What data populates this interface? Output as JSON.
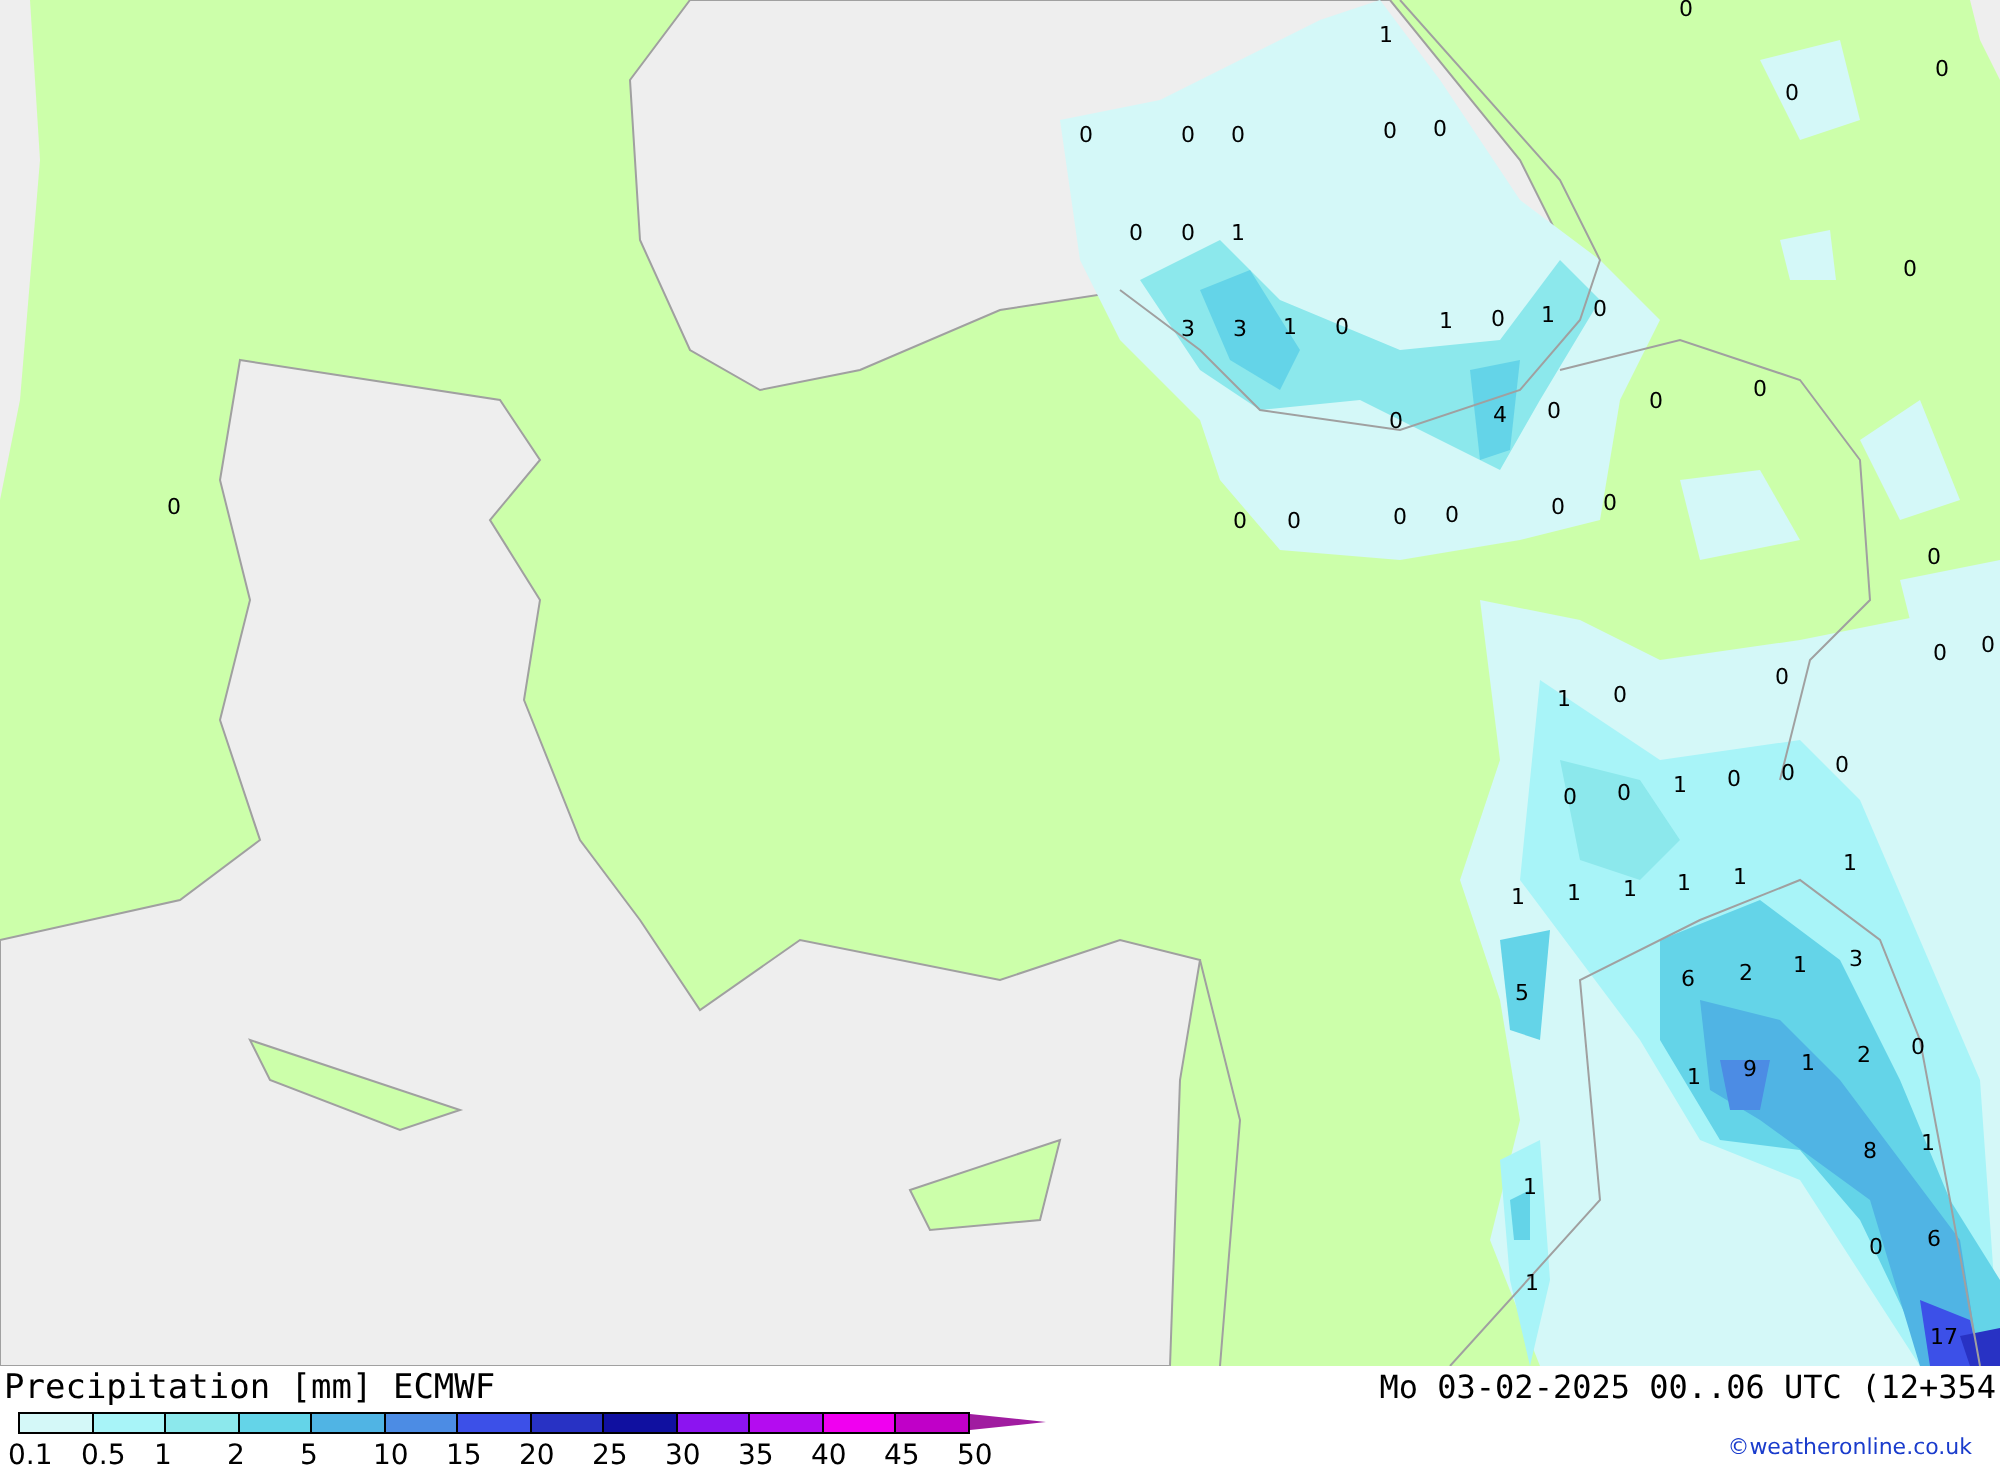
{
  "map": {
    "values": [
      "1",
      "0",
      "0",
      "0",
      "0",
      "0",
      "0",
      "0",
      "0",
      "0",
      "0",
      "1",
      "3",
      "3",
      "1",
      "0",
      "1",
      "0",
      "1",
      "0",
      "0",
      "0",
      "0",
      "0",
      "4",
      "0",
      "0",
      "0",
      "0",
      "0",
      "0",
      "0",
      "0",
      "0",
      "0",
      "0",
      "0",
      "1",
      "0",
      "0",
      "0",
      "1",
      "0",
      "0",
      "0",
      "1",
      "1",
      "1",
      "1",
      "1",
      "1",
      "5",
      "6",
      "2",
      "1",
      "3",
      "1",
      "9",
      "1",
      "2",
      "0",
      "8",
      "1",
      "1",
      "0",
      "6",
      "1",
      "17"
    ]
  },
  "legend": {
    "title": "Precipitation [mm] ECMWF",
    "date": "Mo 03-02-2025 00..06 UTC (12+354",
    "credit": "©weatheronline.co.uk",
    "bins": [
      {
        "color": "#d4f8f8"
      },
      {
        "color": "#a8f4f8"
      },
      {
        "color": "#8ce8ec"
      },
      {
        "color": "#64d4e8"
      },
      {
        "color": "#50b4e4"
      },
      {
        "color": "#4c8ce4"
      },
      {
        "color": "#3c50e8"
      },
      {
        "color": "#2832c4"
      },
      {
        "color": "#1010a0"
      },
      {
        "color": "#8c14f0"
      },
      {
        "color": "#b40cf0"
      },
      {
        "color": "#f000f0"
      },
      {
        "color": "#c000c8"
      }
    ],
    "ticks": [
      "0.1",
      "0.5",
      "1",
      "2",
      "5",
      "10",
      "15",
      "20",
      "25",
      "30",
      "35",
      "40",
      "45",
      "50"
    ]
  }
}
